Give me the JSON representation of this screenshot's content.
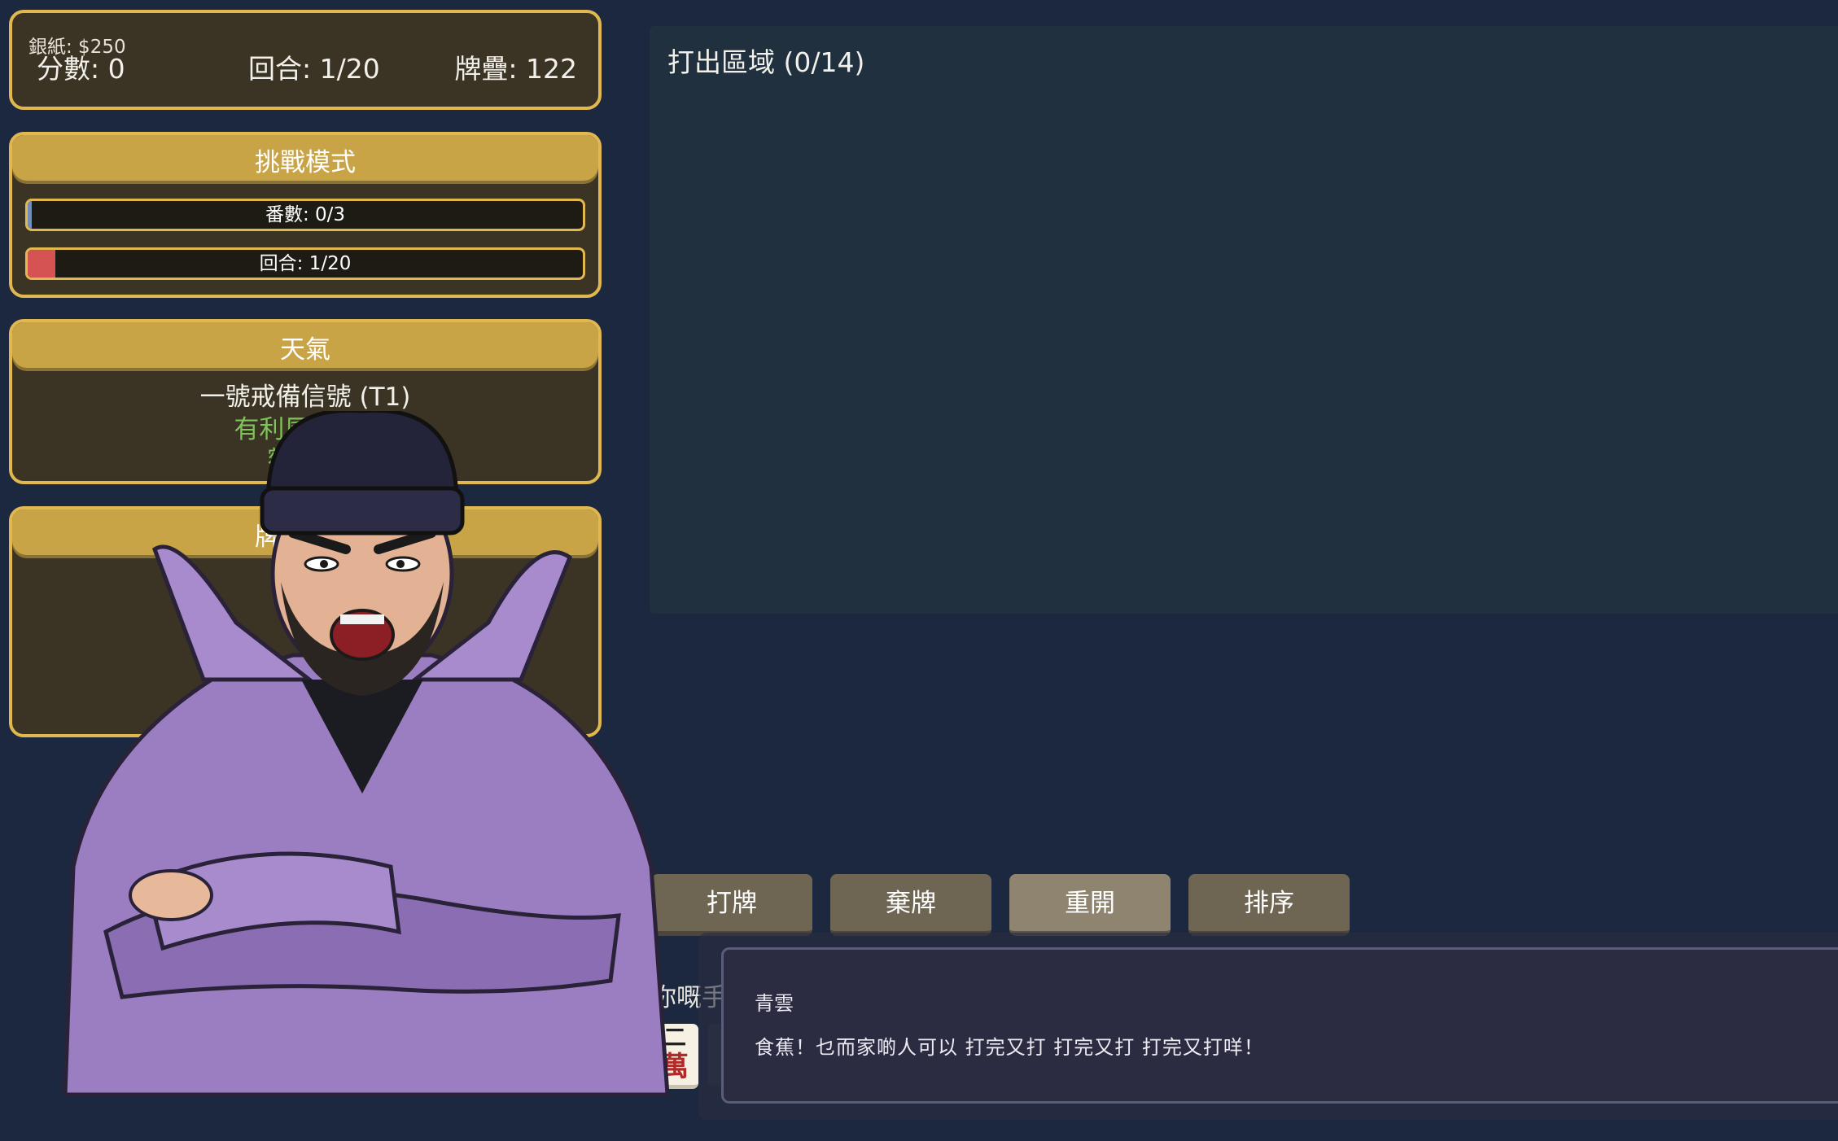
{
  "stats": {
    "money": "銀紙: $250",
    "score": "分數: 0",
    "round": "回合: 1/20",
    "deck": "牌疊: 122"
  },
  "challenge": {
    "title": "挑戰模式",
    "fan_text": "番數: 0/3",
    "fan_progress": 0,
    "round_text": "回合: 1/20",
    "round_progress": 0.05
  },
  "weather": {
    "title": "天氣",
    "name": "一號戒備信號 (T1)",
    "wind": "有利風向: 東",
    "extra": "額外番"
  },
  "deck_panel": {
    "title": "牌疊概覽"
  },
  "play_area": {
    "title": "打出區域 (0/14)"
  },
  "buttons": {
    "play": "打牌",
    "discard": "棄牌",
    "restart": "重開",
    "sort": "排序"
  },
  "hand": {
    "label": "你嘅手牌",
    "first_tile_top": "二",
    "first_tile_bottom": "萬"
  },
  "dialog": {
    "speaker": "青雲",
    "text": "食蕉！乜而家啲人可以 打完又打 打完又打 打完又打咩！"
  },
  "colors": {
    "background": "#1c2840",
    "panel_border": "#e0b84f",
    "panel_header": "#c9a447",
    "panel_fill": "#3b3324",
    "wind_text": "#7fc45a",
    "round_bar": "#d65353"
  },
  "character": {
    "icon": "angry-man-beanie-purple-jacket-portrait"
  }
}
